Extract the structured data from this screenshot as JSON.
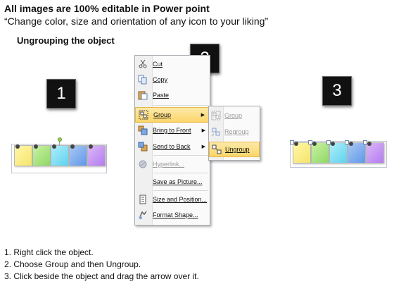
{
  "header": {
    "title": "All images are 100% editable in Power point",
    "subtitle": "“Change color, size and orientation of any icon to your liking”",
    "section": "Ungrouping the object"
  },
  "labels": {
    "one": "1",
    "two": "2",
    "three": "3"
  },
  "note_colors": [
    "#f6e46c",
    "#8fd868",
    "#5fd2ef",
    "#5f97e8",
    "#b47cf0"
  ],
  "context_menu": {
    "items": [
      {
        "label": "Cut",
        "icon": "scissors-icon"
      },
      {
        "label": "Copy",
        "icon": "copy-icon"
      },
      {
        "label": "Paste",
        "icon": "paste-icon"
      },
      {
        "label": "Group",
        "icon": "group-icon",
        "has_submenu": true,
        "active": true
      },
      {
        "label": "Bring to Front",
        "icon": "bring-front-icon",
        "has_submenu": true
      },
      {
        "label": "Send to Back",
        "icon": "send-back-icon",
        "has_submenu": true
      },
      {
        "label": "Hyperlink...",
        "icon": "hyperlink-icon",
        "disabled": true
      },
      {
        "label": "Save as Picture...",
        "icon": ""
      },
      {
        "label": "Size and Position...",
        "icon": "size-position-icon"
      },
      {
        "label": "Format Shape...",
        "icon": "format-shape-icon"
      }
    ]
  },
  "submenu": {
    "items": [
      {
        "label": "Group",
        "icon": "group-icon",
        "disabled": true
      },
      {
        "label": "Regroup",
        "icon": "regroup-icon",
        "disabled": true
      },
      {
        "label": "Ungroup",
        "icon": "ungroup-icon",
        "active": true
      }
    ]
  },
  "steps": [
    "1.  Right click the object.",
    "2.  Choose Group and then Ungroup.",
    "3.  Click beside the object and drag the arrow over it."
  ],
  "colors": {
    "menu_highlight": "#fbd66a",
    "label_box": "#111111"
  }
}
